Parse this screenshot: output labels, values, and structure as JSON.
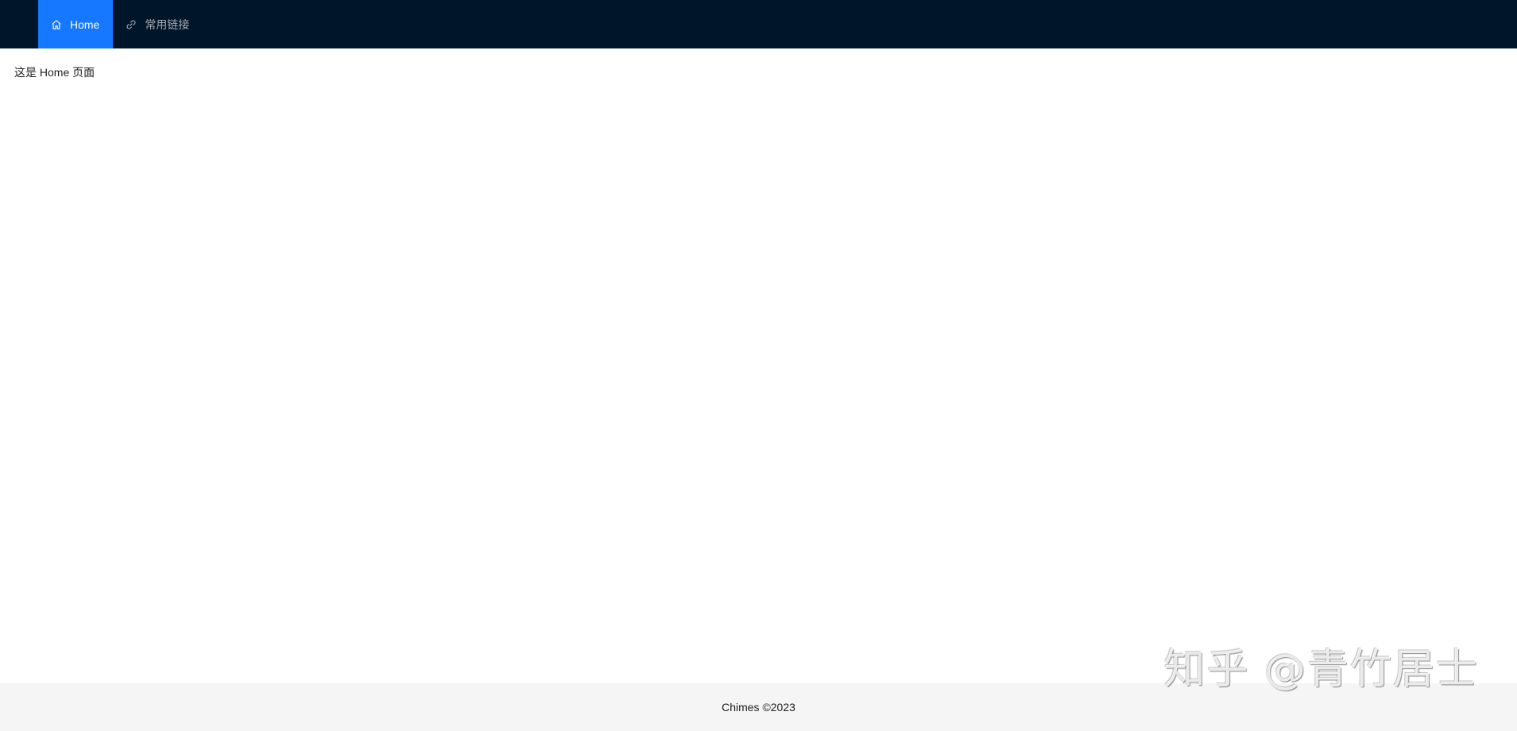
{
  "header": {
    "menu": [
      {
        "label": "Home",
        "icon": "home-icon",
        "selected": true
      },
      {
        "label": "常用链接",
        "icon": "link-icon",
        "selected": false
      }
    ]
  },
  "content": {
    "text": "这是 Home 页面"
  },
  "footer": {
    "text": "Chimes ©2023"
  },
  "watermark": {
    "text": "知乎 @青竹居士"
  },
  "colors": {
    "header_bg": "#001529",
    "selected_bg": "#1677ff",
    "footer_bg": "#f5f5f5"
  }
}
